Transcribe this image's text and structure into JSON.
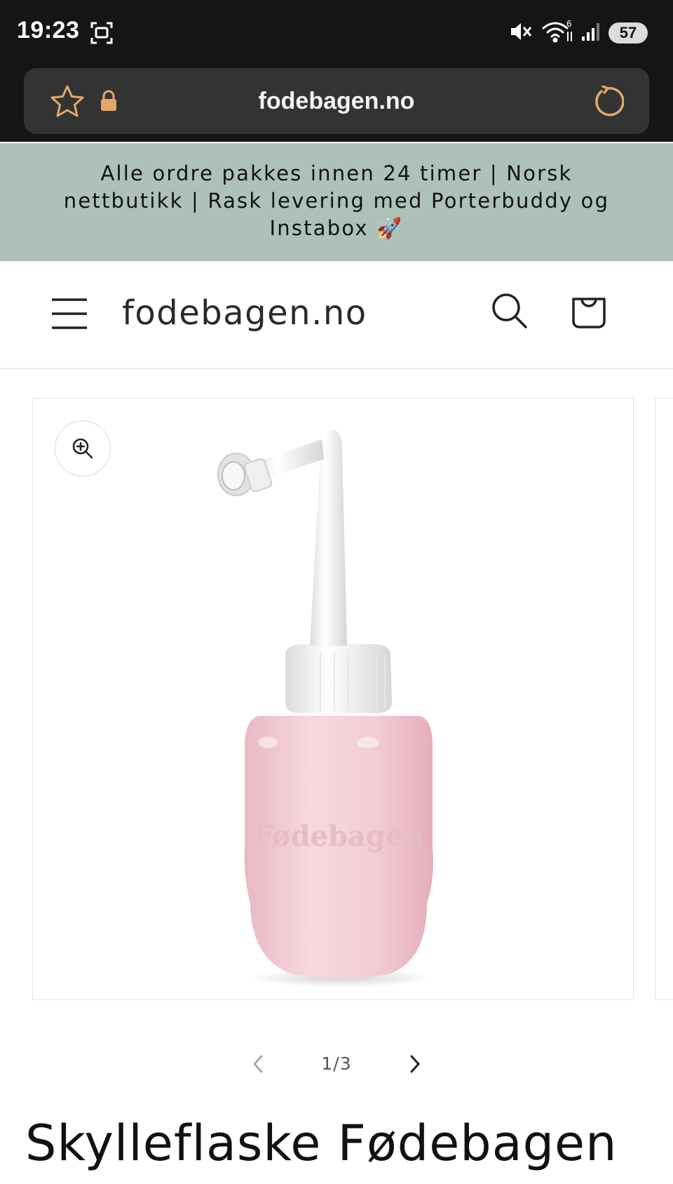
{
  "status_bar": {
    "time": "19:23",
    "battery": "57",
    "icons": [
      "screenshot-icon",
      "mute-icon",
      "wifi-icon",
      "signal-icon",
      "battery-icon"
    ]
  },
  "browser": {
    "url": "fodebagen.no",
    "icons": [
      "star-icon",
      "lock-icon",
      "reload-icon"
    ]
  },
  "announcement": {
    "text": "Alle ordre pakkes innen 24 timer | Norsk nettbutikk | Rask levering med Porterbuddy og Instabox 🚀"
  },
  "header": {
    "logo": "fodebagen.no",
    "icons": [
      "menu-icon",
      "search-icon",
      "cart-icon"
    ]
  },
  "gallery": {
    "current": 1,
    "total": 3,
    "counter": "1/3",
    "bottle_print": "Fødebagen"
  },
  "product": {
    "title": "Skylleflaske Fødebagen"
  },
  "colors": {
    "announcement_bg": "#adc1b8",
    "browser_chrome": "#151515",
    "url_field": "#333333",
    "accent_orange": "#e2a86a",
    "bottle_pink": "#f4cfd7"
  }
}
